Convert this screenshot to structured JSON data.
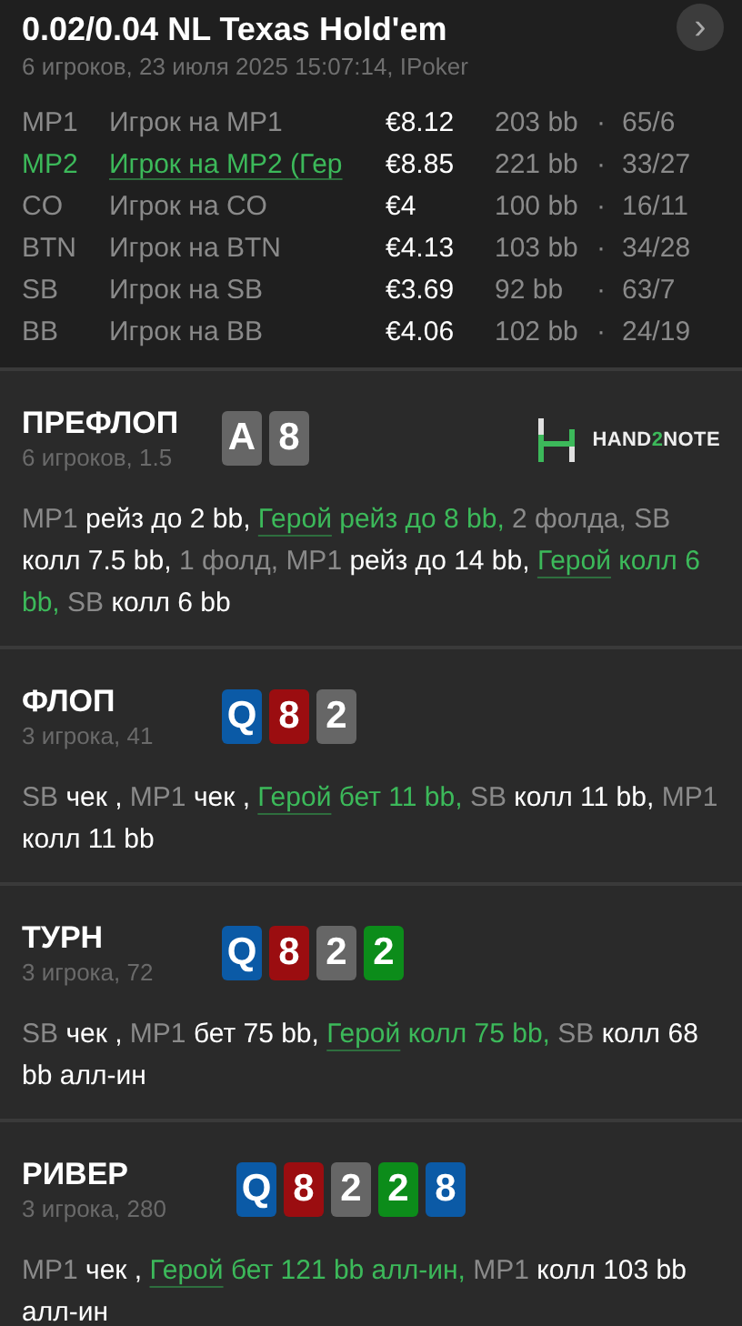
{
  "header": {
    "title": "0.02/0.04 NL Texas Hold'em",
    "subtitle": "6 игроков, 23 июля 2025 15:07:14, IPoker",
    "next_button": "›"
  },
  "players": [
    {
      "position": "MP1",
      "name": "Игрок на MP1",
      "stack": "€8.12",
      "bb": "203 bb",
      "sep": "·",
      "stats": "65/6",
      "hero": false
    },
    {
      "position": "MP2",
      "name": "Игрок на MP2 (Гер",
      "stack": "€8.85",
      "bb": "221 bb",
      "sep": "·",
      "stats": "33/27",
      "hero": true
    },
    {
      "position": "CO",
      "name": "Игрок на CO",
      "stack": "€4",
      "bb": "100 bb",
      "sep": "·",
      "stats": "16/11",
      "hero": false
    },
    {
      "position": "BTN",
      "name": "Игрок на BTN",
      "stack": "€4.13",
      "bb": "103 bb",
      "sep": "·",
      "stats": "34/28",
      "hero": false
    },
    {
      "position": "SB",
      "name": "Игрок на SB",
      "stack": "€3.69",
      "bb": "92 bb",
      "sep": "·",
      "stats": "63/7",
      "hero": false
    },
    {
      "position": "BB",
      "name": "Игрок на BB",
      "stack": "€4.06",
      "bb": "102 bb",
      "sep": "·",
      "stats": "24/19",
      "hero": false
    }
  ],
  "streets": [
    {
      "title": "ПРЕФЛОП",
      "subtitle": "6 игроков, 1.5",
      "cards": [
        {
          "rank": "A",
          "color": "#666666"
        },
        {
          "rank": "8",
          "color": "#666666"
        }
      ],
      "logo": {
        "before": "HAND",
        "accent": "2",
        "after": "NOTE"
      },
      "actions": [
        {
          "kind": "player",
          "text": "MP1"
        },
        {
          "kind": "action",
          "text": "рейз до 2 bb,"
        },
        {
          "kind": "hero",
          "text": "Герой"
        },
        {
          "kind": "hero_action",
          "text": "рейз до 8 bb,"
        },
        {
          "kind": "muted",
          "text": "2 фолда,"
        },
        {
          "kind": "player",
          "text": "SB"
        },
        {
          "kind": "action",
          "text": "колл 7.5 bb,"
        },
        {
          "kind": "muted",
          "text": "1 фолд,"
        },
        {
          "kind": "player",
          "text": "MP1"
        },
        {
          "kind": "action",
          "text": "рейз до 14 bb,"
        },
        {
          "kind": "hero",
          "text": "Герой"
        },
        {
          "kind": "hero_action",
          "text": "колл 6 bb,"
        },
        {
          "kind": "player",
          "text": "SB"
        },
        {
          "kind": "action",
          "text": "колл 6 bb"
        }
      ]
    },
    {
      "title": "ФЛОП",
      "subtitle": "3 игрока, 41",
      "cards": [
        {
          "rank": "Q",
          "color": "#0b5aa6"
        },
        {
          "rank": "8",
          "color": "#9b0d10"
        },
        {
          "rank": "2",
          "color": "#666666"
        }
      ],
      "actions": [
        {
          "kind": "player",
          "text": "SB"
        },
        {
          "kind": "action",
          "text": "чек ,"
        },
        {
          "kind": "player",
          "text": "MP1"
        },
        {
          "kind": "action",
          "text": "чек ,"
        },
        {
          "kind": "hero",
          "text": "Герой"
        },
        {
          "kind": "hero_action",
          "text": "бет 11 bb,"
        },
        {
          "kind": "player",
          "text": "SB"
        },
        {
          "kind": "action",
          "text": "колл 11 bb,"
        },
        {
          "kind": "player",
          "text": "MP1"
        },
        {
          "kind": "action",
          "text": "колл 11 bb"
        }
      ]
    },
    {
      "title": "ТУРН",
      "subtitle": "3 игрока, 72",
      "cards": [
        {
          "rank": "Q",
          "color": "#0b5aa6"
        },
        {
          "rank": "8",
          "color": "#9b0d10"
        },
        {
          "rank": "2",
          "color": "#666666"
        },
        {
          "rank": "2",
          "color": "#0c8c1a"
        }
      ],
      "actions": [
        {
          "kind": "player",
          "text": "SB"
        },
        {
          "kind": "action",
          "text": "чек ,"
        },
        {
          "kind": "player",
          "text": "MP1"
        },
        {
          "kind": "action",
          "text": "бет 75 bb,"
        },
        {
          "kind": "hero",
          "text": "Герой"
        },
        {
          "kind": "hero_action",
          "text": "колл 75 bb,"
        },
        {
          "kind": "player",
          "text": "SB"
        },
        {
          "kind": "action",
          "text": "колл 68 bb алл-ин"
        }
      ]
    },
    {
      "title": "РИВЕР",
      "subtitle": "3 игрока, 280",
      "cards": [
        {
          "rank": "Q",
          "color": "#0b5aa6"
        },
        {
          "rank": "8",
          "color": "#9b0d10"
        },
        {
          "rank": "2",
          "color": "#666666"
        },
        {
          "rank": "2",
          "color": "#0c8c1a"
        },
        {
          "rank": "8",
          "color": "#0b5aa6"
        }
      ],
      "actions": [
        {
          "kind": "player",
          "text": "MP1"
        },
        {
          "kind": "action",
          "text": "чек ,"
        },
        {
          "kind": "hero",
          "text": "Герой"
        },
        {
          "kind": "hero_action",
          "text": "бет 121 bb алл-ин,"
        },
        {
          "kind": "player",
          "text": "MP1"
        },
        {
          "kind": "action",
          "text": "колл 103 bb алл-ин"
        }
      ]
    }
  ]
}
